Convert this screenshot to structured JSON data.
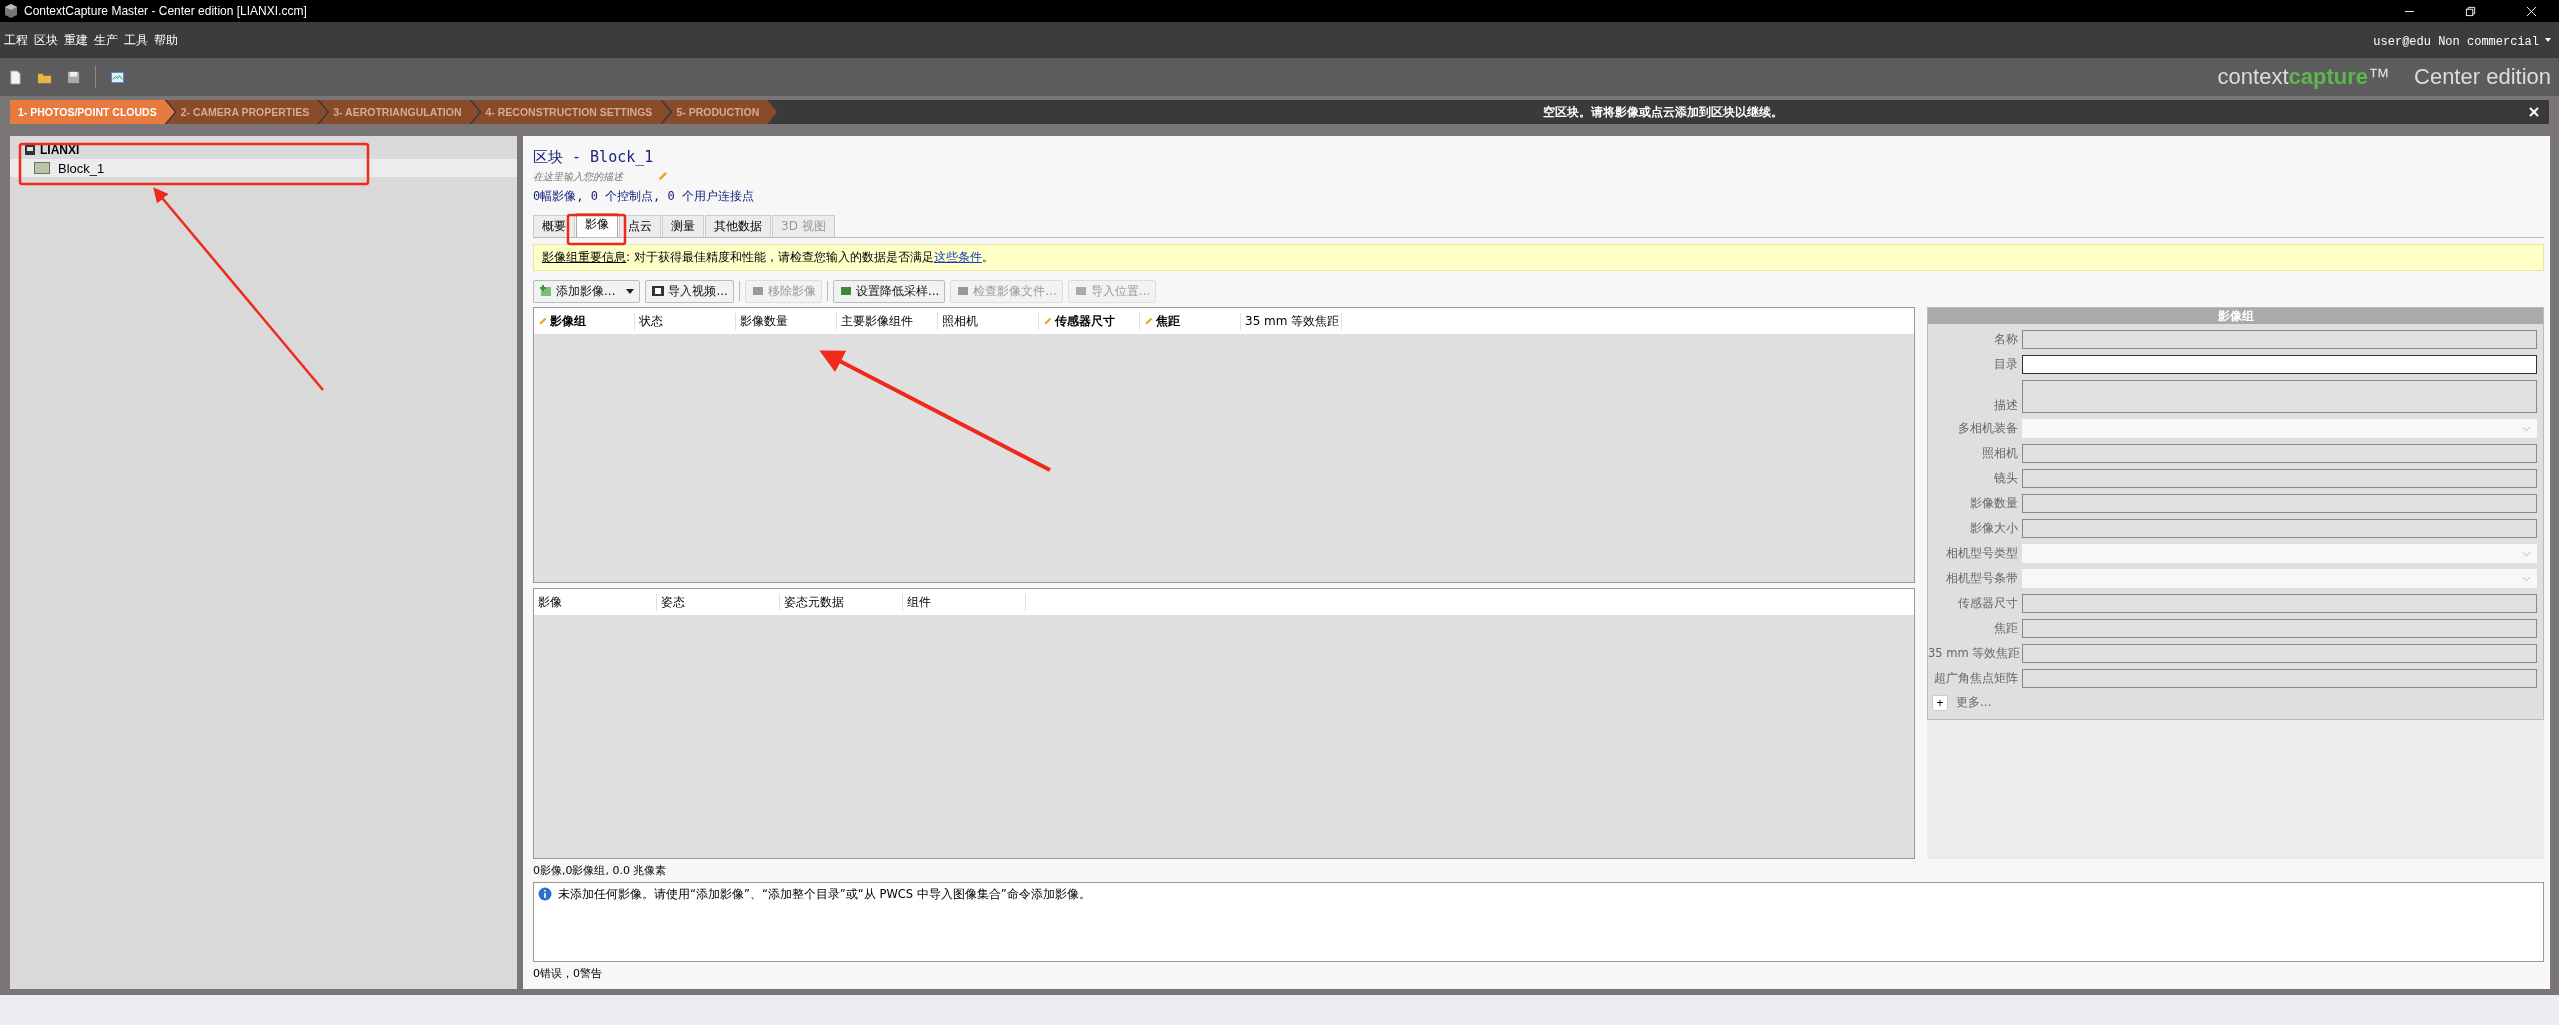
{
  "window": {
    "title": "ContextCapture Master - Center edition [LIANXI.ccm]"
  },
  "menu": [
    "工程",
    "区块",
    "重建",
    "生产",
    "工具",
    "帮助"
  ],
  "account": "user@edu Non commercial",
  "brand": {
    "prefix": "context",
    "highlight": "capture",
    "mark": "™",
    "edition": "Center edition"
  },
  "steps": [
    {
      "label": "1- PHOTOS/POINT CLOUDS",
      "selected": true
    },
    {
      "label": "2- CAMERA PROPERTIES",
      "selected": false
    },
    {
      "label": "3- AEROTRIANGULATION",
      "selected": false
    },
    {
      "label": "4- RECONSTRUCTION SETTINGS",
      "selected": false
    },
    {
      "label": "5- PRODUCTION",
      "selected": false
    }
  ],
  "notice": "空区块。请将影像或点云添加到区块以继续。",
  "tree": {
    "root": "LIANXI",
    "children": [
      {
        "label": "Block_1",
        "selected": true
      }
    ]
  },
  "block": {
    "title": "区块 - Block_1",
    "placeholder": "在这里输入您的描述",
    "summary": "0幅影像, 0 个控制点, 0 个用户连接点"
  },
  "tabs": [
    {
      "label": "概要",
      "selected": false,
      "disabled": false
    },
    {
      "label": "影像",
      "selected": true,
      "disabled": false
    },
    {
      "label": "点云",
      "selected": false,
      "disabled": false
    },
    {
      "label": "测量",
      "selected": false,
      "disabled": false
    },
    {
      "label": "其他数据",
      "selected": false,
      "disabled": false
    },
    {
      "label": "3D 视图",
      "selected": false,
      "disabled": true
    }
  ],
  "info": {
    "heading": "影像组重要信息",
    "text": ": 对于获得最佳精度和性能，请检查您输入的数据是否满足",
    "link": "这些条件",
    "end": "。"
  },
  "toolbar_groups": [
    {
      "buttons": [
        {
          "label": "添加影像...",
          "disabled": false,
          "kind": "split"
        },
        {
          "label": "导入视频...",
          "disabled": false,
          "kind": "video"
        }
      ]
    },
    {
      "buttons": [
        {
          "label": "移除影像",
          "disabled": true,
          "kind": "remove"
        }
      ]
    },
    {
      "buttons": [
        {
          "label": "设置降低采样...",
          "disabled": false,
          "kind": "downsample"
        },
        {
          "label": "检查影像文件...",
          "disabled": true,
          "kind": "check"
        },
        {
          "label": "导入位置...",
          "disabled": true,
          "kind": "import"
        }
      ]
    }
  ],
  "groups_table": {
    "columns": [
      {
        "label": "影像组",
        "editable": true
      },
      {
        "label": "状态",
        "editable": false
      },
      {
        "label": "影像数量",
        "editable": false
      },
      {
        "label": "主要影像组件",
        "editable": false
      },
      {
        "label": "照相机",
        "editable": false
      },
      {
        "label": "传感器尺寸",
        "editable": true
      },
      {
        "label": "焦距",
        "editable": true
      },
      {
        "label": "35 mm 等效焦距",
        "editable": false
      }
    ]
  },
  "photos_table": {
    "columns": [
      "影像",
      "姿态",
      "姿态元数据",
      "组件"
    ]
  },
  "properties": {
    "title": "影像组",
    "fields": [
      {
        "label": "名称",
        "kind": "text",
        "disabled": true
      },
      {
        "label": "目录",
        "kind": "text",
        "disabled": false
      },
      {
        "label": "描述",
        "kind": "multiline",
        "disabled": true
      },
      {
        "label": "多相机装备",
        "kind": "dropdown",
        "disabled": true
      },
      {
        "label": "照相机",
        "kind": "text",
        "disabled": true
      },
      {
        "label": "镜头",
        "kind": "text",
        "disabled": true
      },
      {
        "label": "影像数量",
        "kind": "text",
        "disabled": true
      },
      {
        "label": "影像大小",
        "kind": "text",
        "disabled": true
      },
      {
        "label": "相机型号类型",
        "kind": "dropdown",
        "disabled": true
      },
      {
        "label": "相机型号条带",
        "kind": "dropdown",
        "disabled": true
      },
      {
        "label": "传感器尺寸",
        "kind": "text",
        "disabled": true
      },
      {
        "label": "焦距",
        "kind": "text",
        "disabled": true
      },
      {
        "label": "35 mm 等效焦距",
        "kind": "text",
        "disabled": true
      },
      {
        "label": "超广角焦点矩阵",
        "kind": "text",
        "disabled": true
      }
    ],
    "expand": "+",
    "more": "更多..."
  },
  "stats": "0影像,0影像组, 0.0 兆像素",
  "message": "未添加任何影像。请使用“添加影像”、“添加整个目录”或“从 PWCS 中导入图像集合”命令添加影像。",
  "errors": "0错误，0警告"
}
